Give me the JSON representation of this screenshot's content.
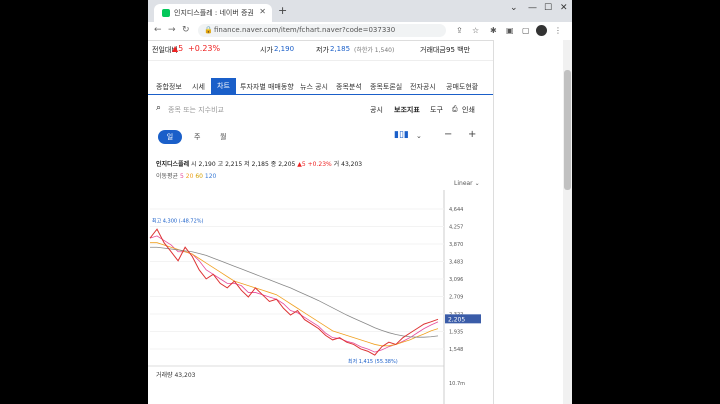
{
  "browser": {
    "tab_title": "인지디스플레 : 네이버 증권",
    "url": "finance.naver.com/item/fchart.naver?code=037330"
  },
  "summary": {
    "prev_label": "전일대비",
    "change": "▲5",
    "change_pct": "+0.23%",
    "open_label": "시가",
    "open": "2,190",
    "low_label": "저가",
    "low": "2,185",
    "low_limit": "(하한가 1,540)",
    "amount_label": "거래대금",
    "amount": "95 백만"
  },
  "nav_tabs": [
    "종합정보",
    "시세",
    "차트",
    "투자자별 매매동향",
    "뉴스 공시",
    "종목분석",
    "종목토론실",
    "전자공시",
    "공매도현황"
  ],
  "toolbar": {
    "search_placeholder": "종목 또는 지수비교",
    "disclosure": "공시",
    "indicators": "보조지표",
    "tools": "도구",
    "print": "인쇄"
  },
  "periods": [
    "일",
    "주",
    "월"
  ],
  "ohlc": {
    "name": "인지디스플레",
    "open_label": "시",
    "open": "2,190",
    "high_label": "고",
    "high": "2,215",
    "low_label": "저",
    "low": "2,185",
    "close_label": "종",
    "close": "2,205",
    "change": "▲5",
    "change_pct": "+0.23%",
    "vol_label": "거",
    "volume": "43,203"
  },
  "ma": {
    "label": "이동평균",
    "p1": "5",
    "p2": "20",
    "p3": "60",
    "p4": "120"
  },
  "chart": {
    "scale": "Linear",
    "max_label": "최고 4,300 (-48.72%)",
    "min_label": "최저 1,415 (55.38%)",
    "last_label": "2,205",
    "volume_label": "거래량",
    "volume": "43,203",
    "volume_axis": "10.7m"
  },
  "chart_data": {
    "type": "line",
    "price_ticks": [
      "4,644",
      "4,257",
      "3,870",
      "3,483",
      "3,096",
      "2,709",
      "2,322",
      "1,935",
      "1,548"
    ],
    "price_tick_values": [
      4644,
      4257,
      3870,
      3483,
      3096,
      2709,
      2322,
      1935,
      1548
    ],
    "ylim": [
      1350,
      4800
    ],
    "max": 4300,
    "min": 1415,
    "last": 2205,
    "close_series": [
      4000,
      4200,
      3900,
      3700,
      3500,
      3800,
      3600,
      3300,
      3100,
      3200,
      3000,
      2900,
      3050,
      2850,
      2700,
      2900,
      2750,
      2600,
      2650,
      2450,
      2300,
      2400,
      2200,
      2100,
      2000,
      1850,
      1750,
      1800,
      1700,
      1650,
      1550,
      1500,
      1415,
      1600,
      1700,
      1650,
      1800,
      1900,
      2000,
      2100,
      2150,
      2205
    ],
    "ma_series": [
      {
        "name": "5",
        "values": [
          4000,
          4050,
          3950,
          3850,
          3700,
          3700,
          3650,
          3500,
          3300,
          3200,
          3100,
          3000,
          3000,
          2950,
          2800,
          2800,
          2750,
          2700,
          2650,
          2550,
          2400,
          2350,
          2250,
          2150,
          2050,
          1900,
          1800,
          1780,
          1720,
          1680,
          1600,
          1550,
          1480,
          1530,
          1600,
          1650,
          1720,
          1800,
          1900,
          2000,
          2080,
          2150
        ]
      },
      {
        "name": "20",
        "values": [
          3900,
          3900,
          3850,
          3800,
          3750,
          3700,
          3650,
          3550,
          3450,
          3350,
          3250,
          3150,
          3050,
          3000,
          2950,
          2900,
          2850,
          2800,
          2750,
          2650,
          2550,
          2450,
          2350,
          2250,
          2150,
          2050,
          1950,
          1900,
          1850,
          1800,
          1750,
          1700,
          1650,
          1620,
          1620,
          1650,
          1700,
          1750,
          1820,
          1880,
          1950,
          2000
        ]
      },
      {
        "name": "60",
        "values": [
          3800,
          3800,
          3780,
          3760,
          3740,
          3720,
          3700,
          3660,
          3620,
          3560,
          3500,
          3440,
          3380,
          3320,
          3260,
          3200,
          3140,
          3080,
          3020,
          2960,
          2900,
          2830,
          2760,
          2690,
          2620,
          2540,
          2460,
          2380,
          2300,
          2230,
          2160,
          2090,
          2020,
          1960,
          1910,
          1870,
          1840,
          1820,
          1810,
          1810,
          1820,
          1840
        ]
      }
    ]
  }
}
